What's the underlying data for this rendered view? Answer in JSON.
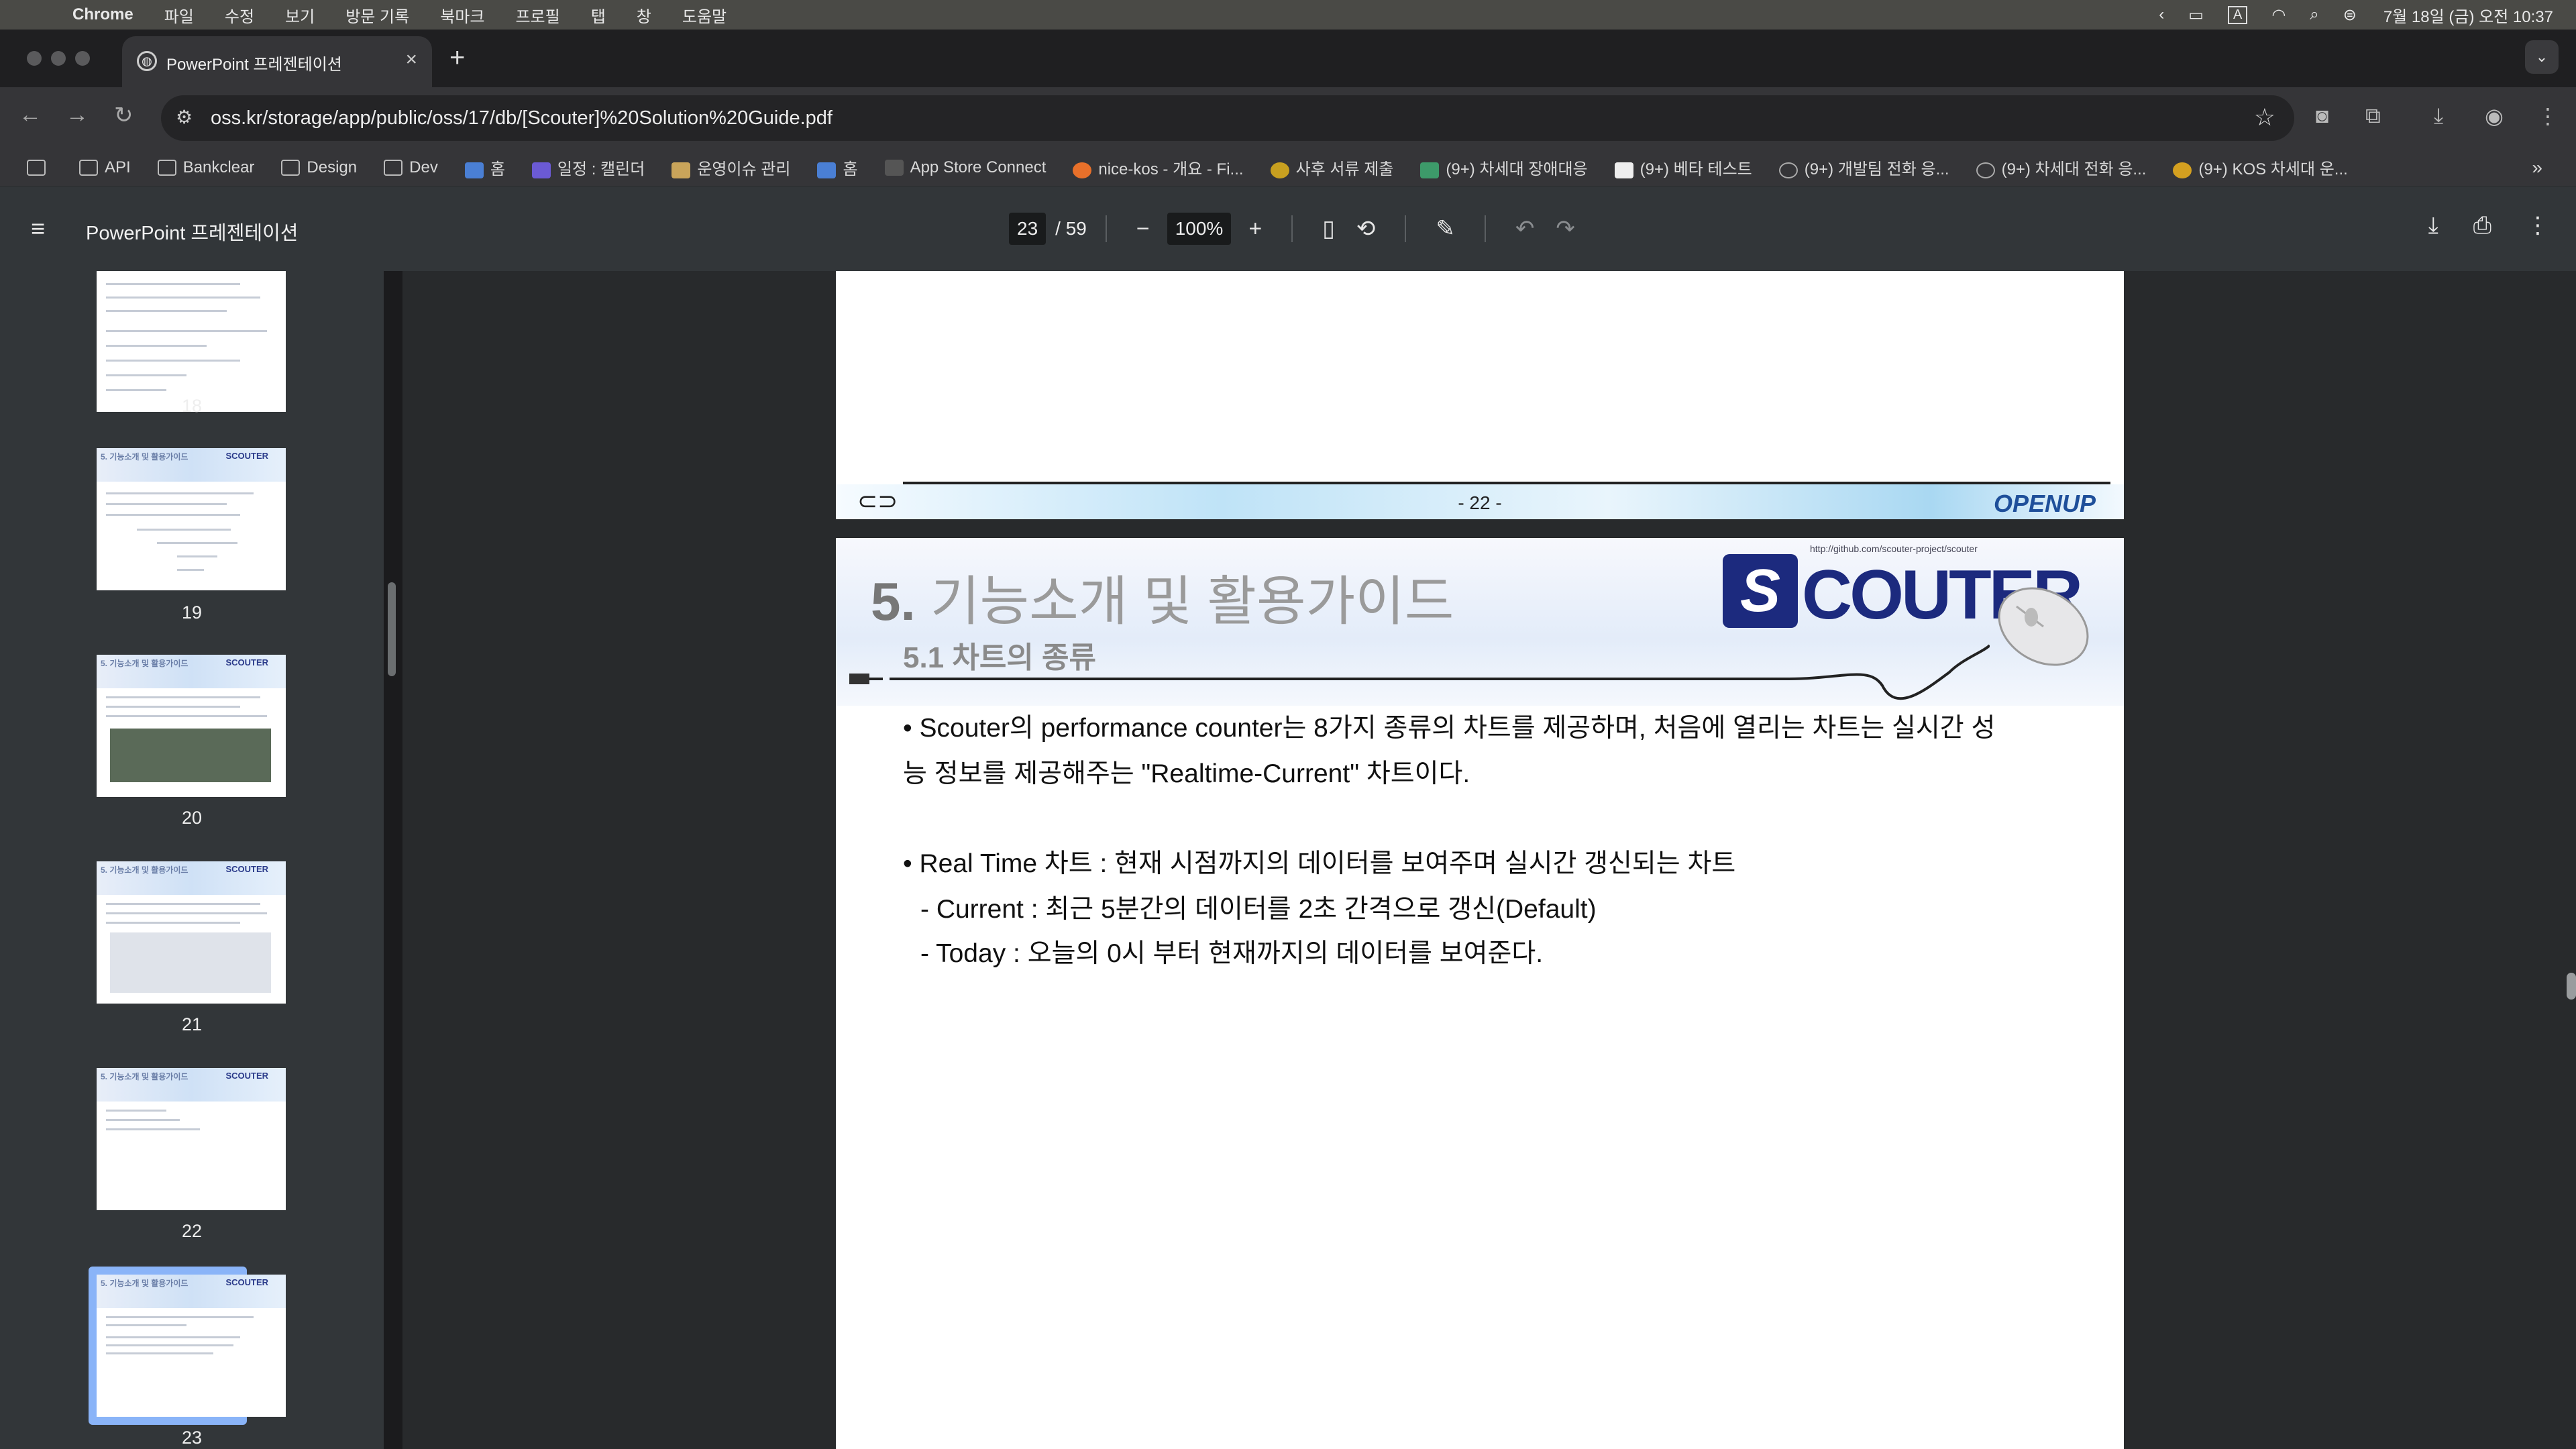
{
  "menubar": {
    "app": "Chrome",
    "items": [
      "파일",
      "수정",
      "보기",
      "방문 기록",
      "북마크",
      "프로필",
      "탭",
      "창",
      "도움말"
    ],
    "clock": "7월 18일 (금) 오전 10:37",
    "input_indicator": "A"
  },
  "tab": {
    "title": "PowerPoint 프레젠테이션"
  },
  "omnibox": {
    "url": "oss.kr/storage/app/public/oss/17/db/[Scouter]%20Solution%20Guide.pdf"
  },
  "bookmarks": [
    {
      "label": "",
      "icon": "apps-grid-icon"
    },
    {
      "label": "API",
      "icon": "folder-icon"
    },
    {
      "label": "Bankclear",
      "icon": "folder-icon"
    },
    {
      "label": "Design",
      "icon": "folder-icon"
    },
    {
      "label": "Dev",
      "icon": "folder-icon"
    },
    {
      "label": "홈",
      "icon": "app-icon"
    },
    {
      "label": "일정 : 캘린더",
      "icon": "calendar-icon"
    },
    {
      "label": "운영이슈 관리",
      "icon": "app-icon"
    },
    {
      "label": "홈",
      "icon": "app-icon"
    },
    {
      "label": "App Store Connect",
      "icon": "apple-icon"
    },
    {
      "label": "nice-kos - 개요 - Fi...",
      "icon": "flame-icon"
    },
    {
      "label": "사후 서류 제출",
      "icon": "badge-icon"
    },
    {
      "label": "(9+) 차세대 장애대응",
      "icon": "app-icon"
    },
    {
      "label": "(9+) 베타 테스트",
      "icon": "notion-icon"
    },
    {
      "label": "(9+) 개발팀 전화 응...",
      "icon": "phone-icon"
    },
    {
      "label": "(9+) 차세대 전화 응...",
      "icon": "phone-icon"
    },
    {
      "label": "(9+) KOS 차세대 운...",
      "icon": "flower-icon"
    }
  ],
  "pdf": {
    "title": "PowerPoint 프레젠테이션",
    "current_page": "23",
    "total_pages": "/ 59",
    "zoom": "100%"
  },
  "thumbnails": [
    {
      "page": "18"
    },
    {
      "page": "19"
    },
    {
      "page": "20"
    },
    {
      "page": "21"
    },
    {
      "page": "22"
    },
    {
      "page": "23",
      "selected": true
    }
  ],
  "thumb_header": {
    "section": "5. 기능소개 및 활용가이드",
    "logo": "SCOUTER"
  },
  "prev_page": {
    "page_number": "- 22 -",
    "logo": "OPENUP"
  },
  "slide": {
    "heading_number": "5.",
    "heading": "기능소개 및 활용가이드",
    "subheading": "5.1 차트의 종류",
    "logo": "COUTER",
    "logo_mark": "S",
    "logo_url": "http://github.com/scouter-project/scouter",
    "bullet1_line1": "• Scouter의 performance counter는 8가지 종류의 차트를 제공하며, 처음에 열리는 차트는 실시간 성",
    "bullet1_line2": "능 정보를 제공해주는 \"Realtime-Current\" 차트이다.",
    "bullet2": "• Real Time 차트 : 현재 시점까지의 데이터를 보여주며 실시간 갱신되는 차트",
    "sub1": "- Current : 최근 5분간의 데이터를 2초 간격으로 갱신(Default)",
    "sub2": "- Today : 오늘의 0시 부터 현재까지의 데이터를 보여준다."
  }
}
